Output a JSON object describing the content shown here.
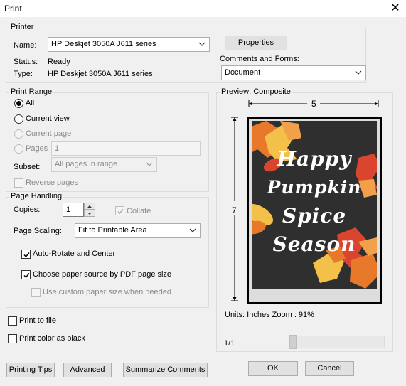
{
  "window": {
    "title": "Print",
    "close_glyph": "✕"
  },
  "printer": {
    "legend": "Printer",
    "name_label": "Name:",
    "name_value": "HP Deskjet 3050A J611 series",
    "status_label": "Status:",
    "status_value": "Ready",
    "type_label": "Type:",
    "type_value": "HP Deskjet 3050A J611 series",
    "properties_button": "Properties",
    "comments_label": "Comments and Forms:",
    "comments_value": "Document"
  },
  "print_range": {
    "legend": "Print Range",
    "options": [
      {
        "label": "All",
        "selected": true,
        "enabled": true
      },
      {
        "label": "Current view",
        "selected": false,
        "enabled": true
      },
      {
        "label": "Current page",
        "selected": false,
        "enabled": false
      },
      {
        "label": "Pages",
        "selected": false,
        "enabled": false
      }
    ],
    "pages_value": "1",
    "subset_label": "Subset:",
    "subset_value": "All pages in range",
    "reverse_label": "Reverse pages"
  },
  "page_handling": {
    "legend": "Page Handling",
    "copies_label": "Copies:",
    "copies_value": "1",
    "collate_label": "Collate",
    "scaling_label": "Page Scaling:",
    "scaling_value": "Fit to Printable Area",
    "auto_rotate_label": "Auto-Rotate and Center",
    "paper_source_label": "Choose paper source by PDF page size",
    "custom_paper_label": "Use custom paper size when needed"
  },
  "options": {
    "print_to_file_label": "Print to file",
    "print_black_label": "Print color as black"
  },
  "preview": {
    "legend": "Preview: Composite",
    "width_label": "5",
    "height_label": "7",
    "poster_lines": [
      "Happy",
      "Pumpkin",
      "Spice",
      "Season"
    ],
    "units_text": "Units: Inches Zoom :  91%",
    "page_counter": "1/1"
  },
  "buttons": {
    "printing_tips": "Printing Tips",
    "advanced": "Advanced",
    "summarize": "Summarize Comments",
    "ok": "OK",
    "cancel": "Cancel"
  },
  "colors": {
    "poster_bg": "#2f2f2f",
    "leaf_orange": "#e8782a",
    "leaf_red": "#d9452e",
    "leaf_yellow": "#f3c04a"
  }
}
